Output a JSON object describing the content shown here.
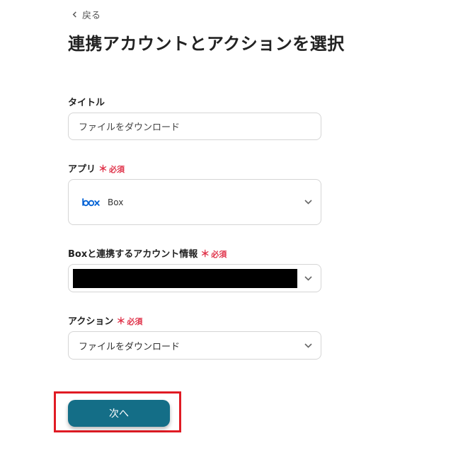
{
  "nav": {
    "back_label": "戻る"
  },
  "page": {
    "title": "連携アカウントとアクションを選択"
  },
  "form": {
    "title_field": {
      "label": "タイトル",
      "value": "ファイルをダウンロード"
    },
    "app_field": {
      "label": "アプリ",
      "required_mark": "＊",
      "required_text": "必須",
      "value": "Box",
      "logo_icon": "box-logo"
    },
    "account_field": {
      "label": "Boxと連携するアカウント情報",
      "required_mark": "＊",
      "required_text": "必須"
    },
    "action_field": {
      "label": "アクション",
      "required_mark": "＊",
      "required_text": "必須",
      "value": "ファイルをダウンロード"
    }
  },
  "footer": {
    "next_label": "次へ"
  },
  "colors": {
    "primary_button": "#146e87",
    "required": "#e0334a",
    "highlight_border": "#e01b24",
    "box_brand": "#0061d5"
  }
}
